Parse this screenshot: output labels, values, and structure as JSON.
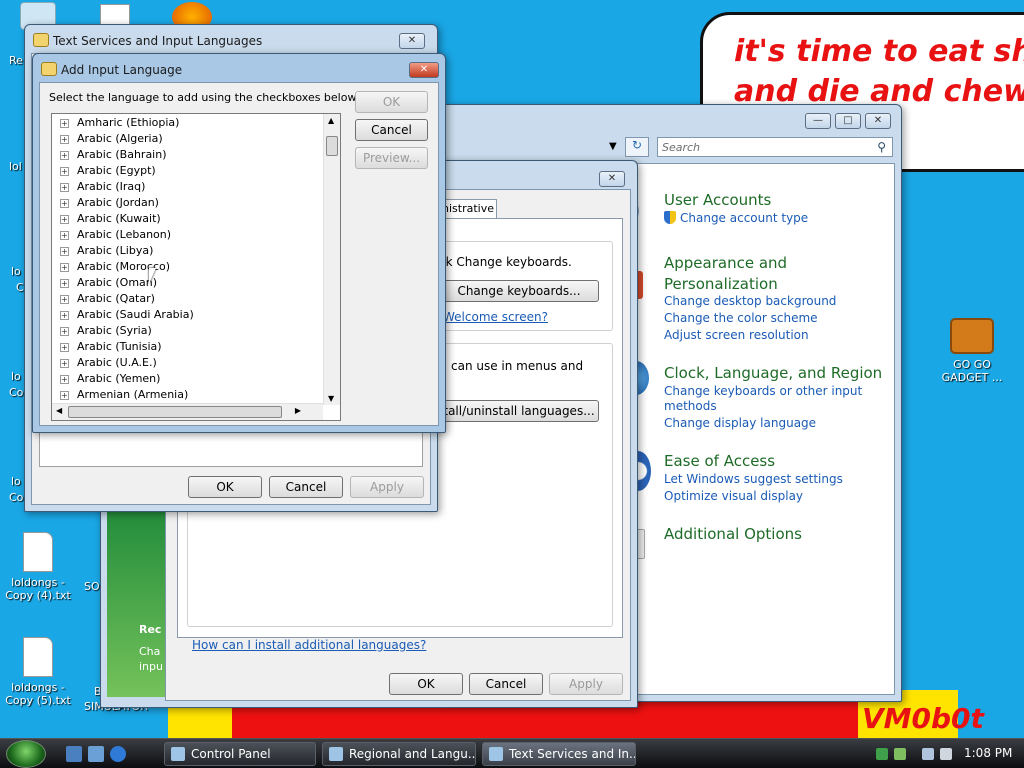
{
  "desktop": {
    "speech_text": "it's time to eat shit\nand die and chew\n            m",
    "signature": "VM0b0t",
    "icons": [
      {
        "label": "loldongs -\nCopy (4).txt"
      },
      {
        "label": "loldongs -\nCopy (5).txt"
      },
      {
        "label": "GO GO\nGADGET ..."
      }
    ],
    "edge_labels": [
      "Re",
      "lol",
      "lo",
      "C",
      "lo",
      "Co",
      "lo",
      "Co",
      "SO",
      "B",
      "SIMULATOR"
    ]
  },
  "text_services": {
    "title": "Text Services and Input Languages",
    "ok": "OK",
    "cancel": "Cancel",
    "apply": "Apply"
  },
  "add_language": {
    "title": "Add Input Language",
    "instruction": "Select the language to add using the checkboxes below.",
    "ok": "OK",
    "cancel": "Cancel",
    "preview": "Preview...",
    "languages": [
      "Amharic (Ethiopia)",
      "Arabic (Algeria)",
      "Arabic (Bahrain)",
      "Arabic (Egypt)",
      "Arabic (Iraq)",
      "Arabic (Jordan)",
      "Arabic (Kuwait)",
      "Arabic (Lebanon)",
      "Arabic (Libya)",
      "Arabic (Morocco)",
      "Arabic (Oman)",
      "Arabic (Qatar)",
      "Arabic (Saudi Arabia)",
      "Arabic (Syria)",
      "Arabic (Tunisia)",
      "Arabic (U.A.E.)",
      "Arabic (Yemen)",
      "Armenian (Armenia)"
    ]
  },
  "regional": {
    "tab_label": "nistrative",
    "kb_text": "ck Change keyboards.",
    "change_keyboards": "Change keyboards...",
    "welcome_link": "Welcome screen?",
    "menus_text": "can use in menus and",
    "install_btn": "tall/uninstall languages...",
    "help_link": "How can I install additional languages?",
    "ok": "OK",
    "cancel": "Cancel",
    "apply": "Apply",
    "sidebar_rec": "Rec",
    "sidebar_cha": "Cha",
    "sidebar_inp": "inpu"
  },
  "control_panel": {
    "search_placeholder": "Search",
    "sections": [
      {
        "heading": "User Accounts",
        "links": [
          "Change account type"
        ]
      },
      {
        "heading": "Appearance and\nPersonalization",
        "links": [
          "Change desktop background",
          "Change the color scheme",
          "Adjust screen resolution"
        ]
      },
      {
        "heading": "Clock, Language, and Region",
        "links": [
          "Change keyboards or other input\nmethods",
          "Change display language"
        ]
      },
      {
        "heading": "Ease of Access",
        "links": [
          "Let Windows suggest settings",
          "Optimize visual display"
        ]
      },
      {
        "heading": "Additional Options",
        "links": []
      }
    ]
  },
  "taskbar": {
    "tasks": [
      "Control Panel",
      "Regional and Langu...",
      "Text Services and In..."
    ],
    "clock": "1:08 PM"
  }
}
